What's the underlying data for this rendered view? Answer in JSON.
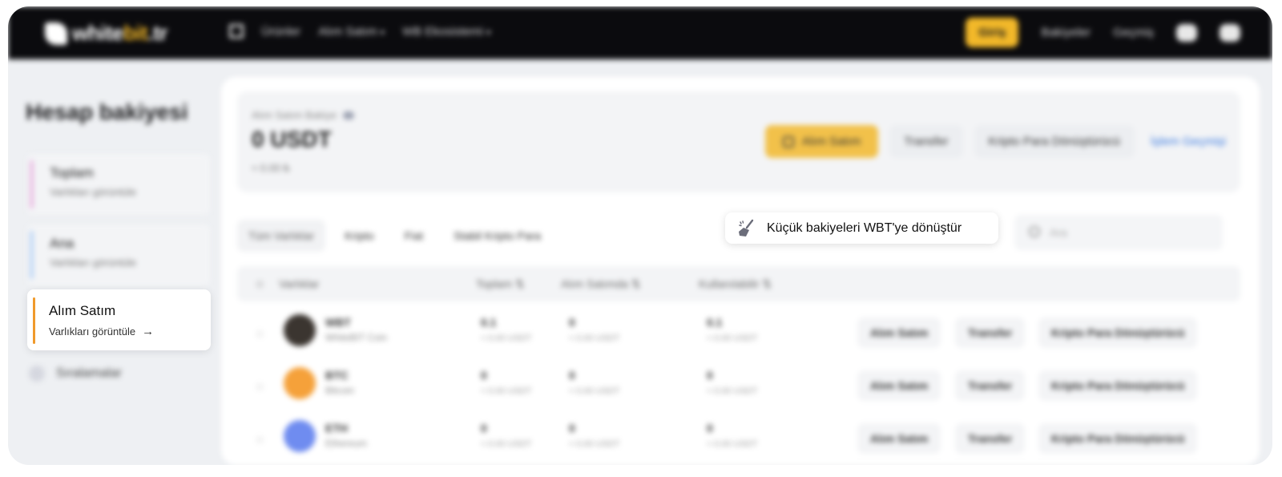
{
  "topbar": {
    "logo_white": "white",
    "logo_bit": "bit",
    "logo_tld": ".tr",
    "nav": [
      "Ürünler",
      "Alım Satım",
      "WB Ekosistemi"
    ],
    "login": "Giriş",
    "balances": "Bakiyeler",
    "history": "Geçmiş"
  },
  "sidebar": {
    "title": "Hesap bakiyesi",
    "cards": [
      {
        "label": "Toplam",
        "sub": "Varlıkları görüntüle"
      },
      {
        "label": "Ana",
        "sub": "Varlıkları görüntüle"
      },
      {
        "label": "Alım Satım",
        "sub": "Varlıkları görüntüle",
        "active": true
      }
    ],
    "faq": "Sıralamalar"
  },
  "summary": {
    "caption": "Alım Satım Bakiye",
    "amount": "0 USDT",
    "sub": "≈ 0.00 ₺",
    "actions": {
      "primary": "Alım Satım",
      "transfer": "Transfer",
      "crypto": "Kripto Para Dönüştürücü",
      "history": "İşlem Geçmişi"
    }
  },
  "tabs": [
    "Tüm Varlıklar",
    "Kripto",
    "Fiat",
    "Stabil Kripto Para"
  ],
  "convert_small": {
    "label": "Küçük bakiyeleri WBT'ye dönüştür"
  },
  "search": {
    "placeholder": "Ara"
  },
  "table": {
    "columns": [
      "Varlıklar",
      "Toplam",
      "Alım Satımda",
      "Kullanılabilir"
    ],
    "rows": [
      {
        "symbol": "WBT",
        "name": "WhiteBIT Coin",
        "total": "0.1",
        "total_usd": "≈ 0.00 USDT",
        "in_order": "0",
        "in_order_usd": "≈ 0.00 USDT",
        "available": "0.1",
        "available_usd": "≈ 0.00 USDT",
        "coin_color": "#3b3530"
      },
      {
        "symbol": "BTC",
        "name": "Bitcoin",
        "total": "0",
        "total_usd": "≈ 0.00 USDT",
        "in_order": "0",
        "in_order_usd": "≈ 0.00 USDT",
        "available": "0",
        "available_usd": "≈ 0.00 USDT",
        "coin_color": "#f5a13a"
      },
      {
        "symbol": "ETH",
        "name": "Ethereum",
        "total": "0",
        "total_usd": "≈ 0.00 USDT",
        "in_order": "0",
        "in_order_usd": "≈ 0.00 USDT",
        "available": "0",
        "available_usd": "≈ 0.00 USDT",
        "coin_color": "#6f8cf0"
      }
    ],
    "row_actions": [
      "Alım Satım",
      "Transfer",
      "Kripto Para Dönüştürücü"
    ]
  }
}
